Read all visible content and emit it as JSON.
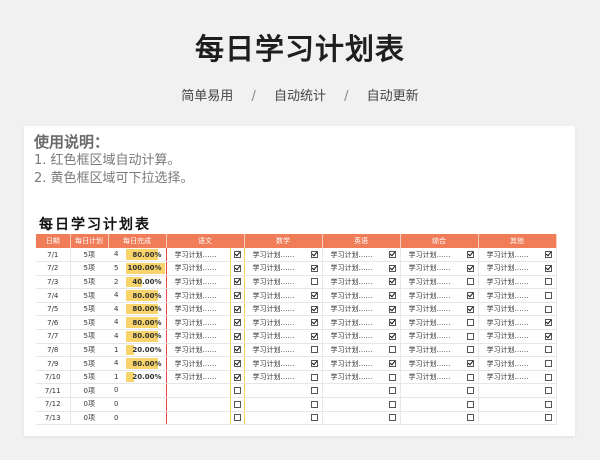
{
  "header": {
    "title": "每日学习计划表",
    "tags": [
      "简单易用",
      "自动统计",
      "自动更新"
    ]
  },
  "instructions": {
    "title": "使用说明：",
    "lines": [
      "1. 红色框区域自动计算。",
      "2. 黄色框区域可下拉选择。"
    ]
  },
  "sheet": {
    "title": "每日学习计划表",
    "headers": [
      "日期",
      "每日计划",
      "每日完成",
      "语文",
      "数学",
      "英语",
      "综合",
      "其他"
    ],
    "colors": {
      "header_bg": "#f07c58",
      "red_frame": "#e8453c",
      "yellow_frame": "#f6d44a",
      "progress_bar": "#f8d46b"
    },
    "rows": [
      {
        "date": "7/1",
        "plan": "5项",
        "done": "4",
        "pct": "80.00%",
        "pct_value": 80,
        "tasks": [
          "学习计划……",
          "学习计划……",
          "学习计划……",
          "学习计划……",
          "学习计划……"
        ],
        "checks": [
          true,
          true,
          true,
          true,
          true
        ]
      },
      {
        "date": "7/2",
        "plan": "5项",
        "done": "5",
        "pct": "100.00%",
        "pct_value": 100,
        "tasks": [
          "学习计划……",
          "学习计划……",
          "学习计划……",
          "学习计划……",
          "学习计划……"
        ],
        "checks": [
          true,
          true,
          true,
          true,
          true
        ]
      },
      {
        "date": "7/3",
        "plan": "5项",
        "done": "2",
        "pct": "40.00%",
        "pct_value": 40,
        "tasks": [
          "学习计划……",
          "学习计划……",
          "学习计划……",
          "学习计划……",
          "学习计划……"
        ],
        "checks": [
          true,
          false,
          true,
          false,
          false
        ]
      },
      {
        "date": "7/4",
        "plan": "5项",
        "done": "4",
        "pct": "80.00%",
        "pct_value": 80,
        "tasks": [
          "学习计划……",
          "学习计划……",
          "学习计划……",
          "学习计划……",
          "学习计划……"
        ],
        "checks": [
          true,
          true,
          true,
          true,
          false
        ]
      },
      {
        "date": "7/5",
        "plan": "5项",
        "done": "4",
        "pct": "80.00%",
        "pct_value": 80,
        "tasks": [
          "学习计划……",
          "学习计划……",
          "学习计划……",
          "学习计划……",
          "学习计划……"
        ],
        "checks": [
          true,
          true,
          true,
          true,
          false
        ]
      },
      {
        "date": "7/6",
        "plan": "5项",
        "done": "4",
        "pct": "80.00%",
        "pct_value": 80,
        "tasks": [
          "学习计划……",
          "学习计划……",
          "学习计划……",
          "学习计划……",
          "学习计划……"
        ],
        "checks": [
          true,
          true,
          true,
          false,
          true
        ]
      },
      {
        "date": "7/7",
        "plan": "5项",
        "done": "4",
        "pct": "80.00%",
        "pct_value": 80,
        "tasks": [
          "学习计划……",
          "学习计划……",
          "学习计划……",
          "学习计划……",
          "学习计划……"
        ],
        "checks": [
          true,
          true,
          true,
          false,
          true
        ]
      },
      {
        "date": "7/8",
        "plan": "5项",
        "done": "1",
        "pct": "20.00%",
        "pct_value": 20,
        "tasks": [
          "学习计划……",
          "学习计划……",
          "学习计划……",
          "学习计划……",
          "学习计划……"
        ],
        "checks": [
          true,
          false,
          false,
          false,
          false
        ]
      },
      {
        "date": "7/9",
        "plan": "5项",
        "done": "4",
        "pct": "80.00%",
        "pct_value": 80,
        "tasks": [
          "学习计划……",
          "学习计划……",
          "学习计划……",
          "学习计划……",
          "学习计划……"
        ],
        "checks": [
          true,
          true,
          true,
          true,
          false
        ]
      },
      {
        "date": "7/10",
        "plan": "5项",
        "done": "1",
        "pct": "20.00%",
        "pct_value": 20,
        "tasks": [
          "学习计划……",
          "学习计划……",
          "学习计划……",
          "学习计划……",
          "学习计划……"
        ],
        "checks": [
          true,
          false,
          false,
          false,
          false
        ]
      },
      {
        "date": "7/11",
        "plan": "0项",
        "done": "0",
        "pct": "",
        "pct_value": 0,
        "tasks": [
          "",
          "",
          "",
          "",
          ""
        ],
        "checks": [
          false,
          false,
          false,
          false,
          false
        ]
      },
      {
        "date": "7/12",
        "plan": "0项",
        "done": "0",
        "pct": "",
        "pct_value": 0,
        "tasks": [
          "",
          "",
          "",
          "",
          ""
        ],
        "checks": [
          false,
          false,
          false,
          false,
          false
        ]
      },
      {
        "date": "7/13",
        "plan": "0项",
        "done": "0",
        "pct": "",
        "pct_value": 0,
        "tasks": [
          "",
          "",
          "",
          "",
          ""
        ],
        "checks": [
          false,
          false,
          false,
          false,
          false
        ]
      }
    ]
  }
}
